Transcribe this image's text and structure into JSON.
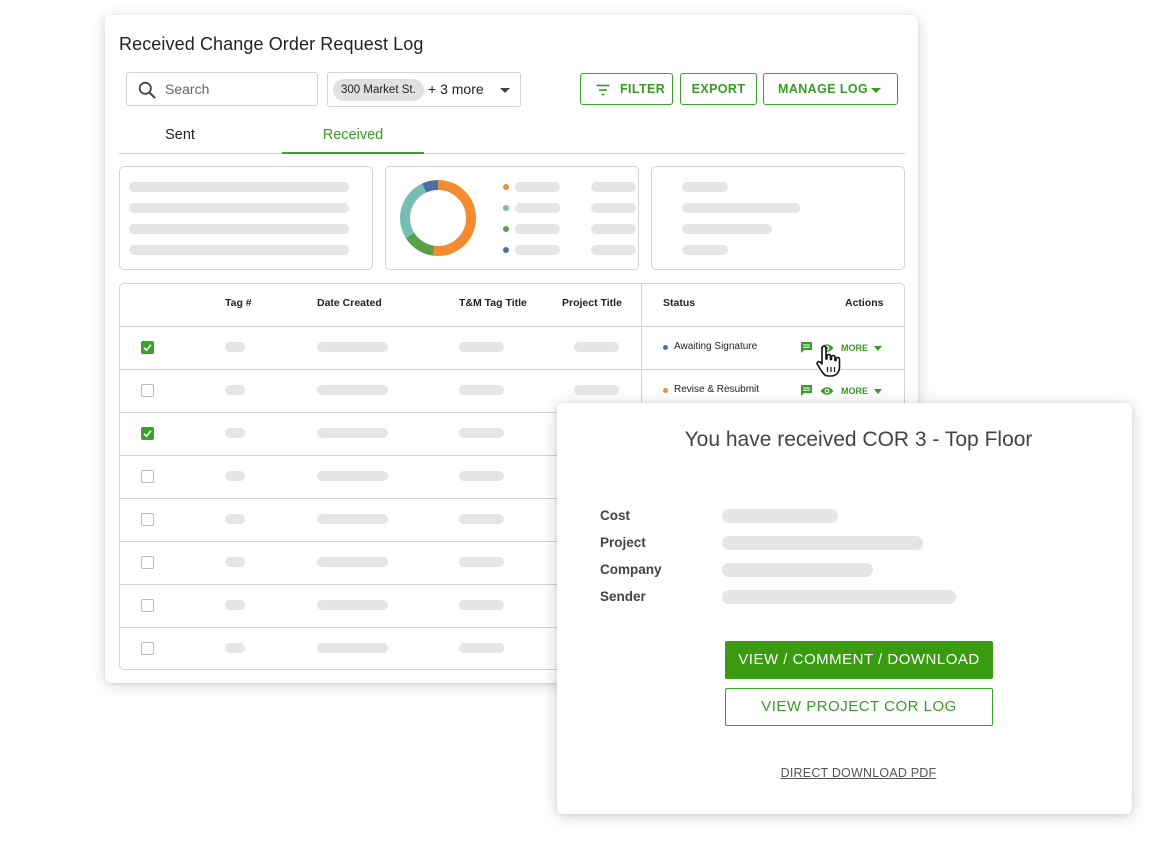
{
  "log": {
    "title": "Received Change Order Request Log",
    "search": {
      "placeholder": "Search",
      "value": ""
    },
    "project_filter": {
      "chip": "300 Market St.",
      "more": "+ 3 more"
    },
    "toolbar": {
      "filter_label": "FILTER",
      "export_label": "EXPORT",
      "manage_log_label": "MANAGE LOG"
    },
    "tabs": [
      {
        "label": "Sent",
        "active": false
      },
      {
        "label": "Received",
        "active": true
      }
    ],
    "donut": {
      "segments": [
        {
          "name": "orange",
          "color": "#f28c2e",
          "fraction": 0.52
        },
        {
          "name": "green",
          "color": "#5aa049",
          "fraction": 0.14
        },
        {
          "name": "teal",
          "color": "#76bdb5",
          "fraction": 0.27
        },
        {
          "name": "blue",
          "color": "#4a6fa5",
          "fraction": 0.07
        }
      ]
    },
    "table": {
      "headers": [
        "Tag #",
        "Date Created",
        "T&M Tag Title",
        "Project Title",
        "Status",
        "Actions"
      ],
      "rows": [
        {
          "checked": true,
          "status": "Awaiting Signature",
          "status_color": "#4a6fa5",
          "more_label": "MORE"
        },
        {
          "checked": false,
          "status": "Revise & Resubmit",
          "status_color": "#f28c2e",
          "more_label": "MORE"
        },
        {
          "checked": true
        },
        {
          "checked": false
        },
        {
          "checked": false
        },
        {
          "checked": false
        },
        {
          "checked": false
        },
        {
          "checked": false
        }
      ]
    }
  },
  "popup": {
    "title": "You have received COR 3 - Top Floor",
    "fields": [
      "Cost",
      "Project",
      "Company",
      "Sender"
    ],
    "primary_button": "VIEW / COMMENT / DOWNLOAD",
    "secondary_button": "VIEW PROJECT COR LOG",
    "download_link": "DIRECT DOWNLOAD PDF"
  },
  "colors": {
    "accent": "#3aa12a",
    "primary_button": "#3a9a10",
    "placeholder_bar": "#e3e5e7"
  }
}
